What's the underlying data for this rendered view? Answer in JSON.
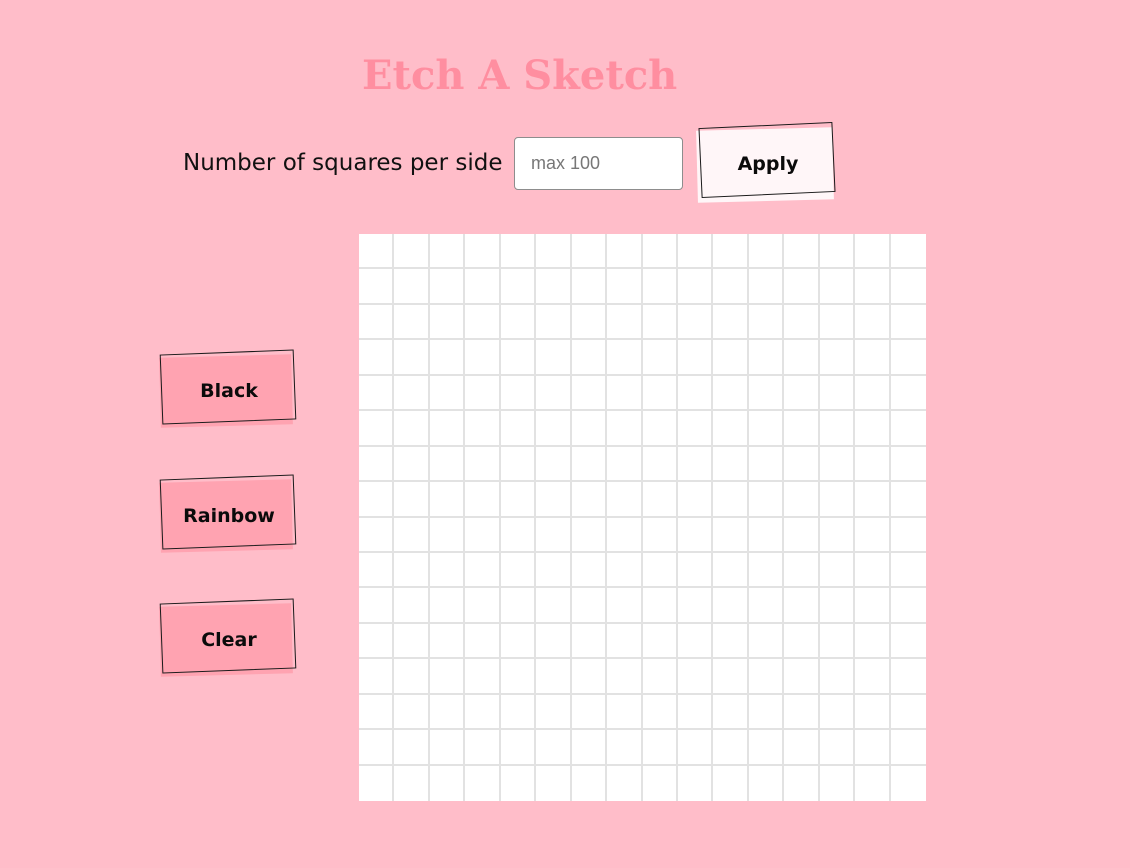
{
  "header": {
    "title": "Etch A Sketch"
  },
  "controls": {
    "size_label": "Number of squares per side",
    "size_input": {
      "value": "",
      "placeholder": "max 100"
    },
    "apply_label": "Apply"
  },
  "modes": {
    "black_label": "Black",
    "rainbow_label": "Rainbow",
    "clear_label": "Clear"
  },
  "grid": {
    "squares_per_side": 16,
    "cell_color": "#ffffff",
    "line_color": "#e2e2e2"
  },
  "colors": {
    "background": "#ffbdc9",
    "title": "#ff8ea0",
    "button_fill": "#ffa3b1",
    "apply_fill": "#fff6f8"
  }
}
